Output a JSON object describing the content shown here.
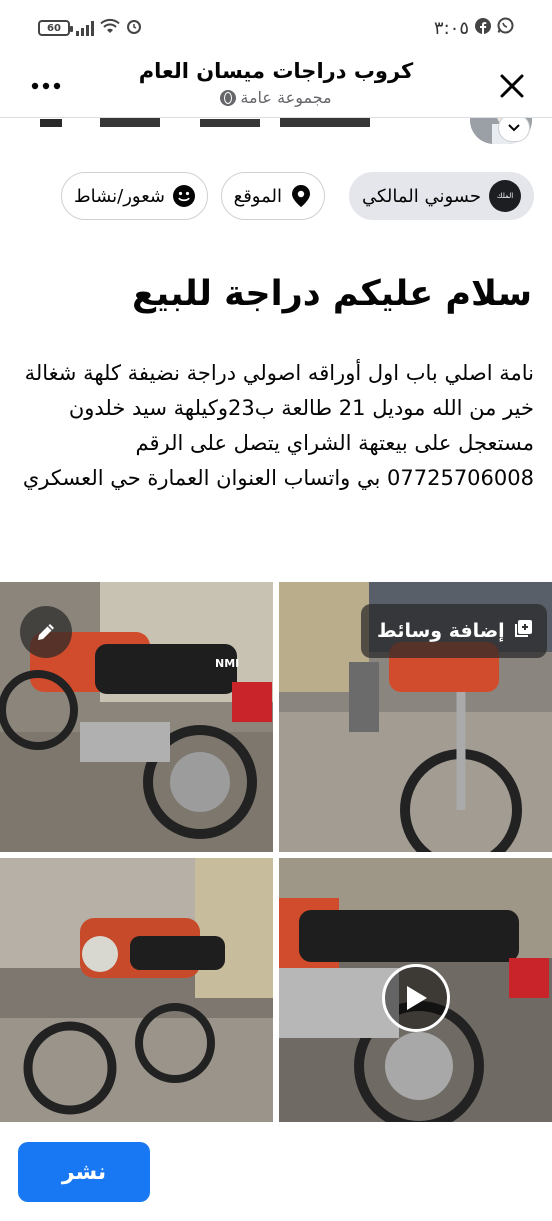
{
  "status_bar": {
    "time": "٣:٠٥",
    "battery": "60",
    "icons": [
      "whatsapp-icon",
      "facebook-icon",
      "alarm-icon",
      "wifi-icon",
      "signal-icon",
      "battery-icon"
    ]
  },
  "header": {
    "group_name": "كروب دراجات ميسان العام",
    "group_privacy": "مجموعة عامة",
    "close_icon": "close-icon",
    "more_icon": "more-icon"
  },
  "chips": {
    "author": "حسوني المالكي",
    "author_avatar_text": "الملك",
    "location": "الموقع",
    "feeling": "شعور/نشاط"
  },
  "post": {
    "title": "سلام عليكم دراجة للبيع",
    "body": "نامة اصلي باب اول أوراقه اصولي دراجة نضيفة كلهة شغالة خير من الله موديل 21 طالعة ب23وكيلهة سيد خلدون مستعجل على بيعتهة الشراي يتصل على الرقم 07725706008 بي واتساب العنوان العمارة حي العسكري"
  },
  "media": {
    "add_media_label": "إضافة وسائط",
    "tiles": [
      {
        "name": "photo-1",
        "kind": "image"
      },
      {
        "name": "photo-2",
        "kind": "image"
      },
      {
        "name": "photo-3",
        "kind": "image"
      },
      {
        "name": "video-1",
        "kind": "video"
      }
    ],
    "plate_text": "NMI"
  },
  "footer": {
    "publish_label": "نشر"
  },
  "colors": {
    "accent": "#1877f2",
    "text": "#050505",
    "secondary_text": "#65676b",
    "chip_selected_bg": "#e4e6eb"
  }
}
